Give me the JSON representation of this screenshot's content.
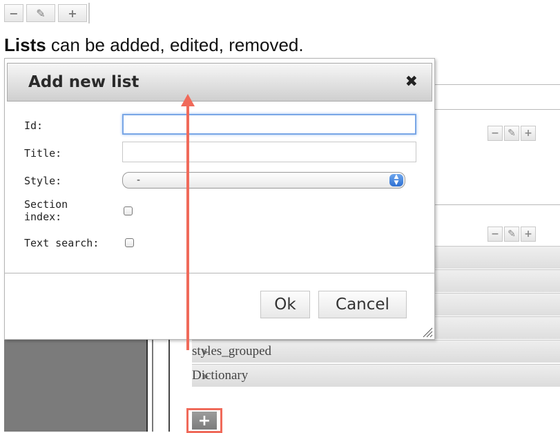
{
  "caption": {
    "bold": "Lists",
    "rest": " can be added, edited, removed."
  },
  "toolbar": {
    "remove": "−",
    "edit": "✎",
    "add": "+"
  },
  "dialog": {
    "title": "Add new list",
    "close": "✖",
    "fields": {
      "id_label": "Id:",
      "id_value": "",
      "title_label": "Title:",
      "title_value": "",
      "style_label": "Style:",
      "style_value": "-",
      "section_label_1": "Section",
      "section_label_2": "index:",
      "text_search_label": "Text search:"
    },
    "ok": "Ok",
    "cancel": "Cancel"
  },
  "background": {
    "rows": [
      {
        "label": "styles_grouped"
      },
      {
        "label": "Dictionary"
      }
    ],
    "mini_toolbar": {
      "remove": "−",
      "edit": "✎",
      "add": "+"
    },
    "add_button": "+"
  },
  "colors": {
    "annotation": "#f06a5a",
    "focus": "#79a6e6"
  }
}
